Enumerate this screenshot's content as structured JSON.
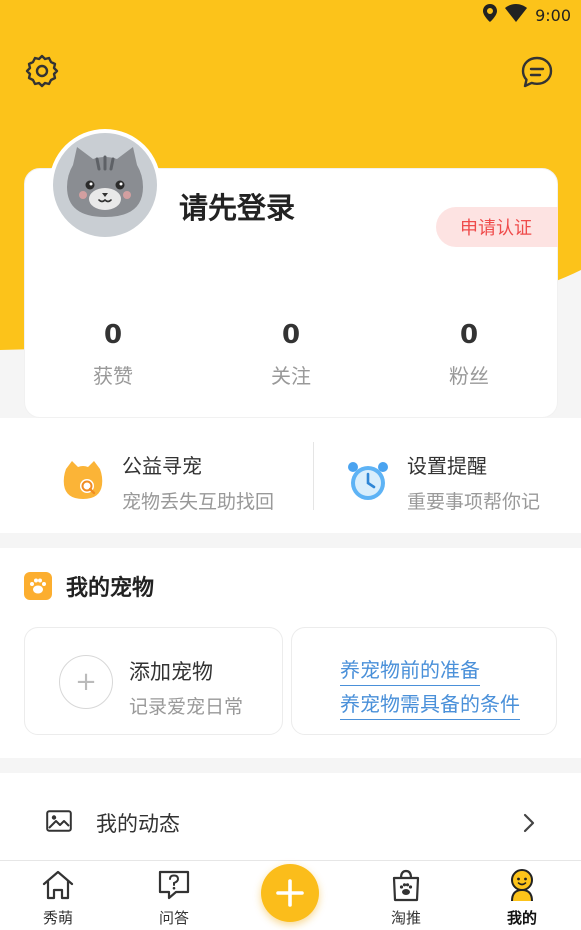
{
  "status_bar": {
    "time": "9:00"
  },
  "profile": {
    "login_prompt": "请先登录",
    "verify_label": "申请认证"
  },
  "stats": [
    {
      "value": "0",
      "label": "获赞"
    },
    {
      "value": "0",
      "label": "关注"
    },
    {
      "value": "0",
      "label": "粉丝"
    }
  ],
  "features": [
    {
      "title": "公益寻宠",
      "subtitle": "宠物丢失互助找回",
      "icon": "cat-search-icon"
    },
    {
      "title": "设置提醒",
      "subtitle": "重要事项帮你记",
      "icon": "alarm-clock-icon"
    }
  ],
  "pets": {
    "section_title": "我的宠物",
    "add_title": "添加宠物",
    "add_subtitle": "记录爱宠日常",
    "links": [
      "养宠物前的准备",
      "养宠物需具备的条件"
    ]
  },
  "moments": {
    "label": "我的动态"
  },
  "tabs": [
    {
      "label": "秀萌",
      "icon": "home-icon"
    },
    {
      "label": "问答",
      "icon": "question-icon"
    },
    {
      "label": "淘推",
      "icon": "shopping-bag-icon"
    },
    {
      "label": "我的",
      "icon": "profile-icon"
    }
  ],
  "colors": {
    "brand_yellow": "#fcc31a",
    "link_blue": "#4a90d9",
    "badge_red": "#ef4b4b"
  }
}
